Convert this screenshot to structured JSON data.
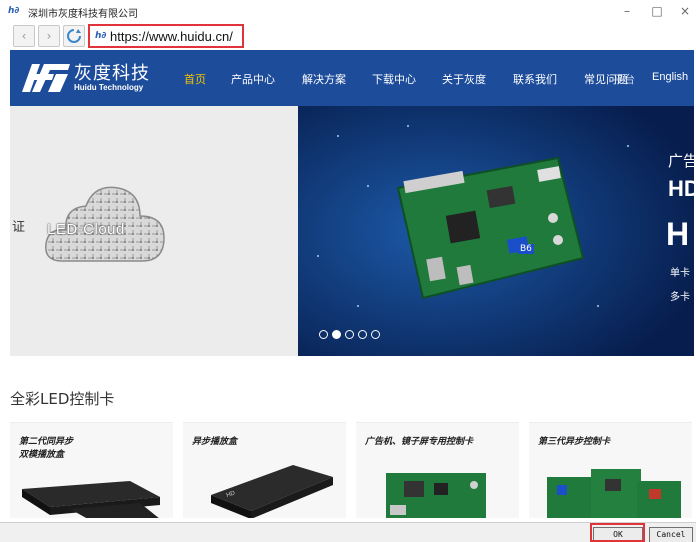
{
  "window": {
    "title": "深圳市灰度科技有限公司",
    "app_icon": "hd-logo-icon",
    "minimize_glyph": "–",
    "maximize_glyph": "□",
    "close_glyph": "×"
  },
  "toolbar": {
    "back_icon": "‹",
    "forward_icon": "›",
    "refresh_icon": "⟳",
    "url": "https://www.huidu.cn/"
  },
  "site": {
    "logo_cn": "灰度科技",
    "logo_en": "Huidu Technology",
    "nav": [
      "首页",
      "产品中心",
      "解决方案",
      "下载中心",
      "关于灰度",
      "联系我们",
      "常见问题",
      "English"
    ],
    "nav_active_index": 0,
    "nav_overlap_text": "平台",
    "colors": {
      "header_bg": "#1d4c9b",
      "nav_active": "#f4c400"
    }
  },
  "hero": {
    "left_edge_char": "证",
    "cloud_label": "LED-Cloud",
    "right_text_1": "广告",
    "right_text_2": "HD",
    "right_text_3": "H",
    "right_text_4": "单卡",
    "right_text_5": "多卡",
    "board_badge": "B6",
    "carousel_dots": 5,
    "carousel_active": 1
  },
  "products": {
    "section_title": "全彩LED控制卡",
    "cards": [
      {
        "title_line1": "第二代同异步",
        "title_line2": "双模播放盒"
      },
      {
        "title_line1": "异步播放盒",
        "title_line2": ""
      },
      {
        "title_line1": "广告机、镜子屏专用控制卡",
        "title_line2": ""
      },
      {
        "title_line1": "第三代异步控制卡",
        "title_line2": ""
      }
    ]
  },
  "dialog": {
    "ok_label": "OK",
    "cancel_label": "Cancel"
  }
}
